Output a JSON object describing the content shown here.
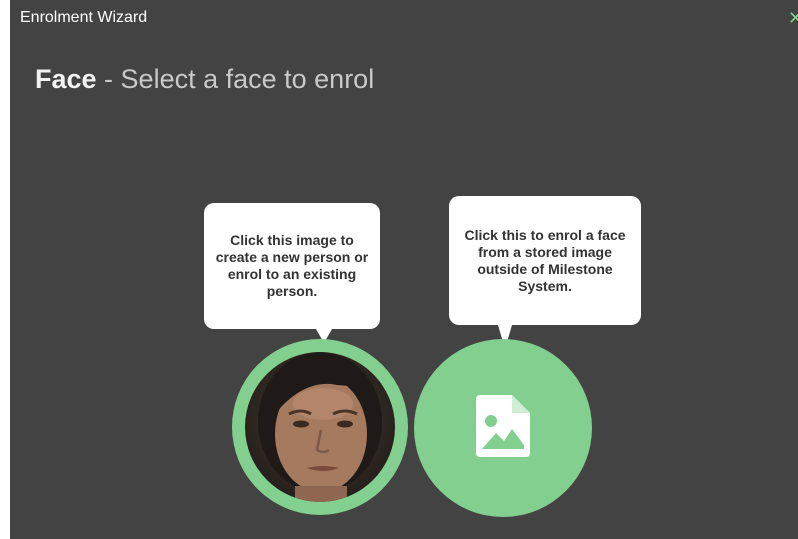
{
  "window": {
    "title": "Enrolment Wizard",
    "close_glyph": "✕"
  },
  "heading": {
    "strong": "Face",
    "rest": " - Select a face to enrol"
  },
  "tooltips": {
    "camera_face": "Click this image to create a new person or enrol to an existing person.",
    "stored_image": "Click this to enrol a face from a stored image outside of Milestone System."
  },
  "icons": {
    "stored_image": "image-file-icon",
    "close": "close-icon"
  },
  "colors": {
    "background": "#434343",
    "accent": "#83cf8f",
    "bubble": "#ffffff"
  }
}
